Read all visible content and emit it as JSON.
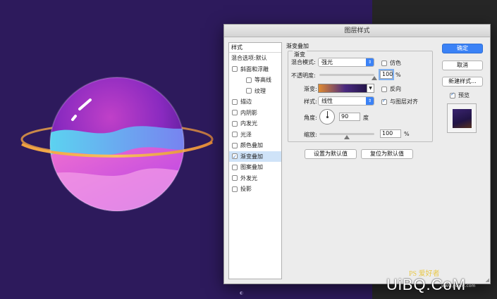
{
  "dialog": {
    "title": "图层样式"
  },
  "styles_list": {
    "header": "样式",
    "items": [
      {
        "label": "混合选项:默认",
        "checkbox": false,
        "checked": false,
        "sub": false,
        "selected": false
      },
      {
        "label": "斜面和浮雕",
        "checkbox": true,
        "checked": false,
        "sub": false,
        "selected": false
      },
      {
        "label": "等高线",
        "checkbox": true,
        "checked": false,
        "sub": true,
        "selected": false
      },
      {
        "label": "纹理",
        "checkbox": true,
        "checked": false,
        "sub": true,
        "selected": false
      },
      {
        "label": "描边",
        "checkbox": true,
        "checked": false,
        "sub": false,
        "selected": false
      },
      {
        "label": "内阴影",
        "checkbox": true,
        "checked": false,
        "sub": false,
        "selected": false
      },
      {
        "label": "内发光",
        "checkbox": true,
        "checked": false,
        "sub": false,
        "selected": false
      },
      {
        "label": "光泽",
        "checkbox": true,
        "checked": false,
        "sub": false,
        "selected": false
      },
      {
        "label": "颜色叠加",
        "checkbox": true,
        "checked": false,
        "sub": false,
        "selected": false
      },
      {
        "label": "渐变叠加",
        "checkbox": true,
        "checked": true,
        "sub": false,
        "selected": true
      },
      {
        "label": "图案叠加",
        "checkbox": true,
        "checked": false,
        "sub": false,
        "selected": false
      },
      {
        "label": "外发光",
        "checkbox": true,
        "checked": false,
        "sub": false,
        "selected": false
      },
      {
        "label": "投影",
        "checkbox": true,
        "checked": false,
        "sub": false,
        "selected": false
      }
    ]
  },
  "gradient_overlay": {
    "section_title": "渐变叠加",
    "group_title": "渐变",
    "blend_mode_label": "混合模式:",
    "blend_mode_value": "强光",
    "dither_label": "仿色",
    "dither_checked": false,
    "opacity_label": "不透明度:",
    "opacity_value": "100",
    "opacity_unit": "%",
    "opacity_level": 1.0,
    "gradient_label": "渐变:",
    "reverse_label": "反向",
    "reverse_checked": false,
    "style_label": "样式:",
    "style_value": "线性",
    "align_label": "与图层对齐",
    "align_checked": true,
    "angle_label": "角度:",
    "angle_value": "90",
    "angle_unit": "度",
    "scale_label": "缩放:",
    "scale_value": "100",
    "scale_unit": "%",
    "scale_level": 0.5,
    "set_default_label": "设置为默认值",
    "reset_default_label": "复位为默认值"
  },
  "buttons": {
    "ok": "确定",
    "cancel": "取消",
    "new_style": "新建样式...",
    "preview_label": "预览",
    "preview_checked": true
  },
  "watermark": {
    "logo": "UiBQ.CoM",
    "sub": "PS 爱好者",
    "url": "www.psahz.com"
  },
  "colors": {
    "accent": "#3b82f6",
    "canvas_bg": "#2d1a5c"
  }
}
